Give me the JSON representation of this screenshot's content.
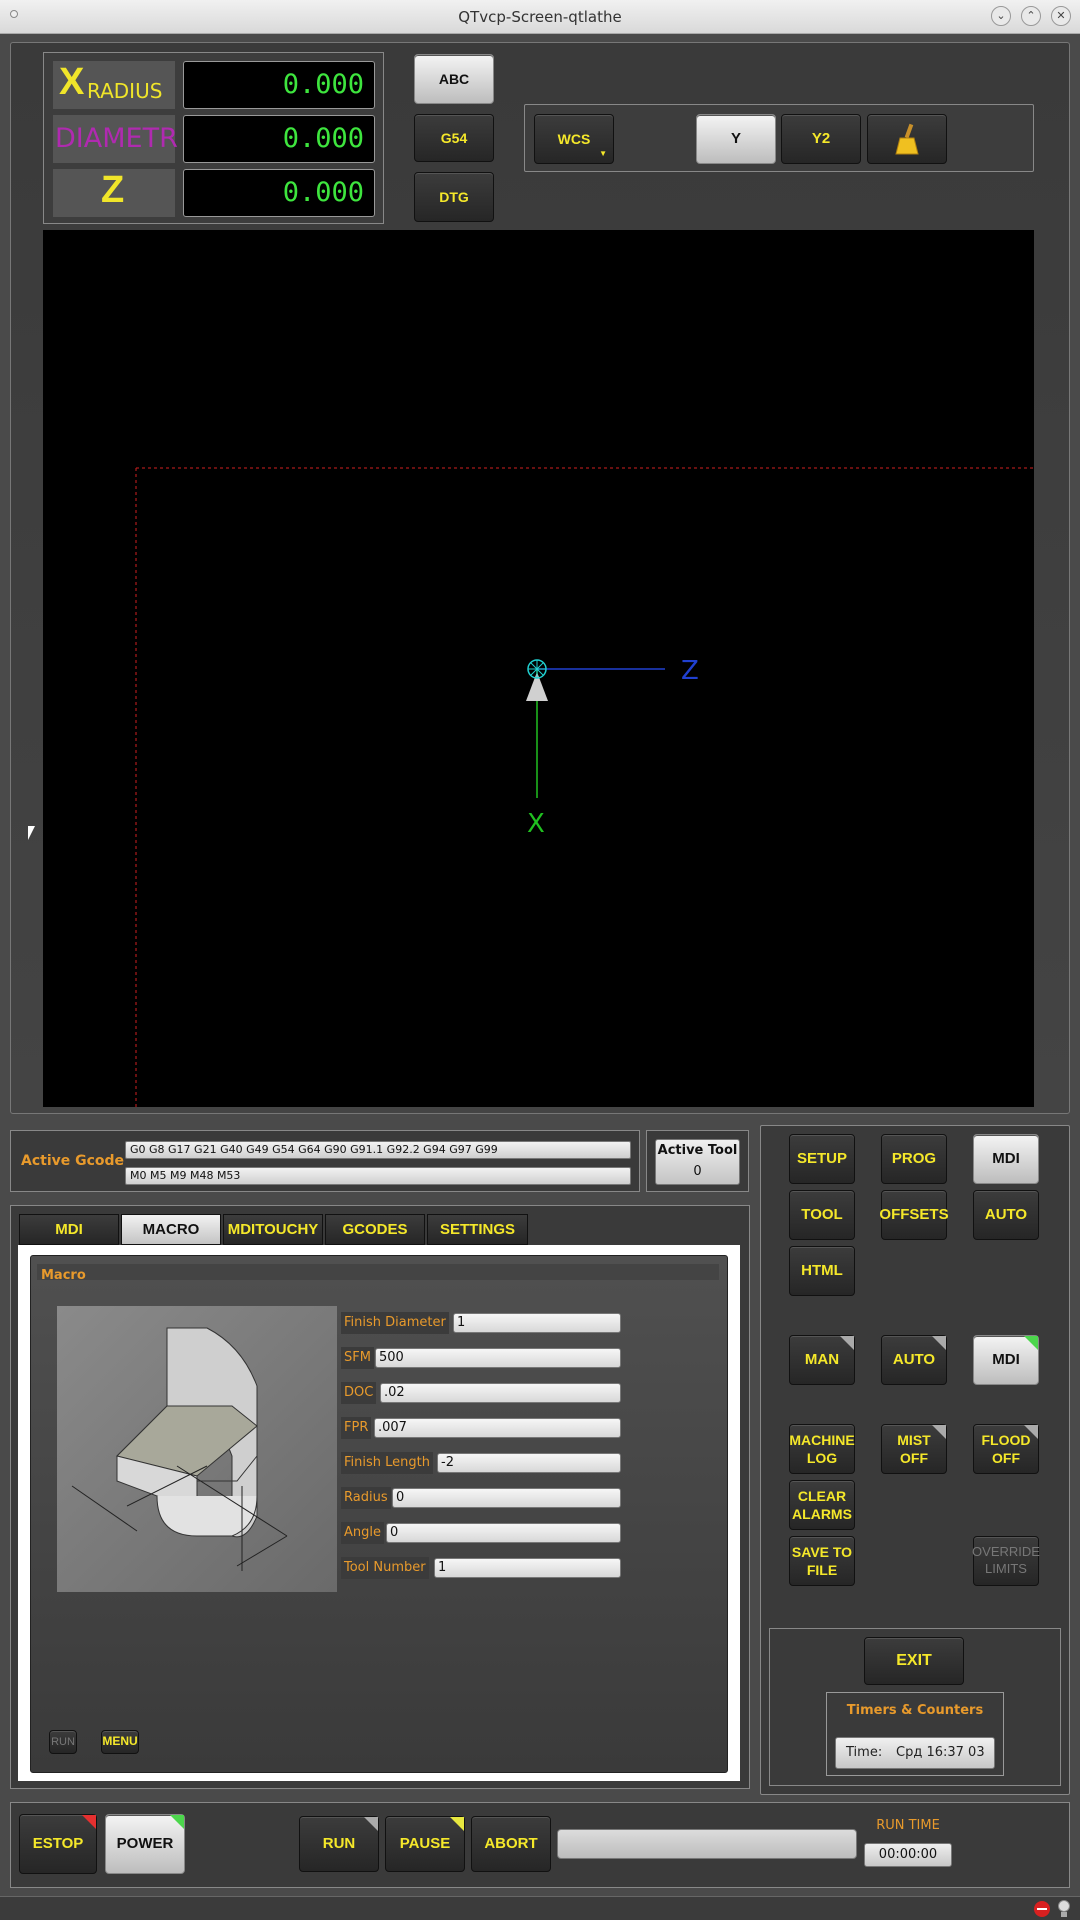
{
  "window": {
    "title": "QTvcp-Screen-qtlathe"
  },
  "dro": {
    "axes": [
      {
        "letter": "X",
        "suffix": "RADIUS",
        "value": "0.000",
        "color": "#f0e52a"
      },
      {
        "letter": "",
        "suffix": "DIAMETR",
        "value": "0.000",
        "color": "#b02ab0"
      },
      {
        "letter": "Z",
        "suffix": "",
        "value": "0.000",
        "color": "#f0e52a"
      }
    ]
  },
  "dro_buttons": {
    "abc": "ABC",
    "g54": "G54",
    "dtg": "DTG"
  },
  "view_buttons": {
    "wcs": "WCS",
    "y": "Y",
    "y2": "Y2",
    "clear_icon": "broom-icon"
  },
  "graphics": {
    "z_axis_label": "Z",
    "x_axis_label": "X"
  },
  "gcode": {
    "label": "Active Gcode",
    "line1": "G0 G8 G17 G21 G40 G49 G54 G64 G90 G91.1 G92.2 G94 G97 G99",
    "line2": "M0 M5 M9 M48 M53"
  },
  "active_tool": {
    "label": "Active Tool",
    "value": "0"
  },
  "tabs": [
    {
      "label": "MDI",
      "selected": false
    },
    {
      "label": "MACRO",
      "selected": true
    },
    {
      "label": "MDITOUCHY",
      "selected": false
    },
    {
      "label": "GCODES",
      "selected": false
    },
    {
      "label": "SETTINGS",
      "selected": false
    }
  ],
  "macro": {
    "title": "Macro",
    "fields": [
      {
        "label": "Finish Diameter",
        "value": "1"
      },
      {
        "label": "SFM",
        "value": "500"
      },
      {
        "label": "DOC",
        "value": ".02"
      },
      {
        "label": "FPR",
        "value": ".007"
      },
      {
        "label": "Finish Length",
        "value": "-2"
      },
      {
        "label": "Radius",
        "value": "0"
      },
      {
        "label": "Angle",
        "value": "0"
      },
      {
        "label": "Tool Number",
        "value": "1"
      }
    ],
    "run_label": "RUN",
    "menu_label": "MENU"
  },
  "mode_buttons": {
    "setup": "SETUP",
    "prog": "PROG",
    "mdi": "MDI",
    "tool": "TOOL",
    "offsets": "OFFSETS",
    "auto": "AUTO",
    "html": "HTML"
  },
  "machine_modes": {
    "man": "MAN",
    "auto": "AUTO",
    "mdi": "MDI"
  },
  "actions": {
    "machine_log": "MACHINE LOG",
    "mist_off": "MIST OFF",
    "flood_off": "FLOOD OFF",
    "clear_alarms": "CLEAR ALARMS",
    "save_to_file": "SAVE TO FILE",
    "override_limits": "OVERRIDE LIMITS"
  },
  "exit_label": "EXIT",
  "timers": {
    "title": "Timers & Counters",
    "time_label": "Time:",
    "time_value": "Срд 16:37 03"
  },
  "bottom": {
    "estop": "ESTOP",
    "power": "POWER",
    "run": "RUN",
    "pause": "PAUSE",
    "abort": "ABORT",
    "run_time_label": "RUN TIME",
    "run_time_value": "00:00:00"
  },
  "colors": {
    "accent": "#f5e82a",
    "orange": "#e89a2c",
    "dro_green": "#3ee53e"
  }
}
